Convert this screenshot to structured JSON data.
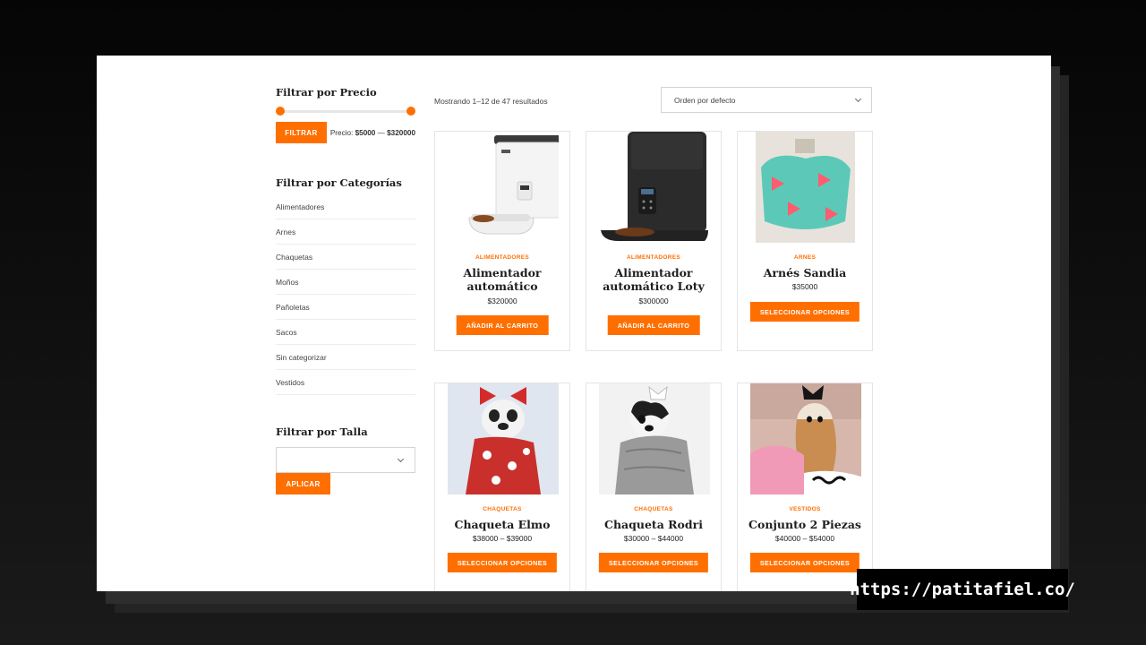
{
  "sidebar": {
    "price_title": "Filtrar por Precio",
    "filter_button": "FILTRAR",
    "price_prefix": "Precio:",
    "price_min": "$5000",
    "price_sep": " — ",
    "price_max": "$320000",
    "categories_title": "Filtrar por Categorías",
    "categories": [
      "Alimentadores",
      "Arnes",
      "Chaquetas",
      "Moños",
      "Pañoletas",
      "Sacos",
      "Sin categorizar",
      "Vestidos"
    ],
    "size_title": "Filtrar por Talla",
    "size_value": "",
    "apply_button": "APLICAR"
  },
  "main": {
    "results_text": "Mostrando 1–12 de 47 resultados",
    "orderby": "Orden por defecto"
  },
  "products": [
    {
      "category": "ALIMENTADORES",
      "name": "Alimentador automático",
      "price": "$320000",
      "button": "AÑADIR AL CARRITO",
      "image": "white-automatic-feeder"
    },
    {
      "category": "ALIMENTADORES",
      "name": "Alimentador automático Loty",
      "price": "$300000",
      "button": "AÑADIR AL CARRITO",
      "image": "black-automatic-feeder"
    },
    {
      "category": "ARNES",
      "name": "Arnés Sandia",
      "price": "$35000",
      "button": "SELECCIONAR OPCIONES",
      "image": "watermelon-harness"
    },
    {
      "category": "CHAQUETAS",
      "name": "Chaqueta Elmo",
      "price": "$38000 – $39000",
      "button": "SELECCIONAR OPCIONES",
      "image": "dog-red-jacket"
    },
    {
      "category": "CHAQUETAS",
      "name": "Chaqueta Rodri",
      "price": "$30000 – $44000",
      "button": "SELECCIONAR OPCIONES",
      "image": "dog-gray-hoodie"
    },
    {
      "category": "VESTIDOS",
      "name": "Conjunto 2 Piezas",
      "price": "$40000 – $54000",
      "button": "SELECCIONAR OPCIONES",
      "image": "dog-pink-dress"
    }
  ],
  "url": "https://patitafiel.co/",
  "colors": {
    "accent": "#ff6f00",
    "page_bg": "#0a0a0a",
    "frame_bg": "#ffffff"
  }
}
